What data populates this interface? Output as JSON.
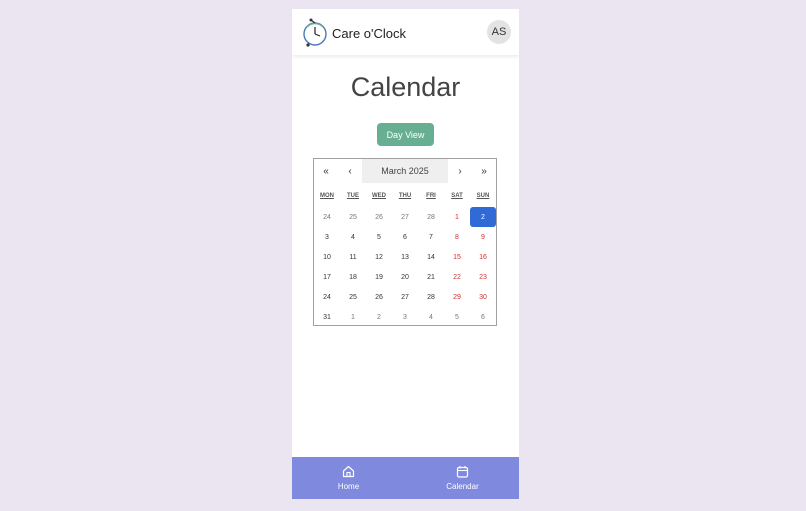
{
  "header": {
    "app_title": "Care o'Clock",
    "avatar_initials": "AS",
    "logo_icon": "clock-logo-icon"
  },
  "page": {
    "title": "Calendar",
    "day_view_label": "Day View"
  },
  "calendar": {
    "prev_year": "«",
    "prev_month": "‹",
    "month_label": "March 2025",
    "next_month": "›",
    "next_year": "»",
    "weekdays": [
      "MON",
      "TUE",
      "WED",
      "THU",
      "FRI",
      "SAT",
      "SUN"
    ],
    "weeks": [
      [
        "24",
        "25",
        "26",
        "27",
        "28",
        "1",
        "2"
      ],
      [
        "3",
        "4",
        "5",
        "6",
        "7",
        "8",
        "9"
      ],
      [
        "10",
        "11",
        "12",
        "13",
        "14",
        "15",
        "16"
      ],
      [
        "17",
        "18",
        "19",
        "20",
        "21",
        "22",
        "23"
      ],
      [
        "24",
        "25",
        "26",
        "27",
        "28",
        "29",
        "30"
      ],
      [
        "31",
        "1",
        "2",
        "3",
        "4",
        "5",
        "6"
      ]
    ],
    "selected_day": "2",
    "colors": {
      "weekend": "#d0312d",
      "selected": "#2f6ad6",
      "other_month": "#777777"
    }
  },
  "bottom_nav": {
    "items": [
      {
        "label": "Home",
        "icon": "home-icon"
      },
      {
        "label": "Calendar",
        "icon": "calendar-icon"
      }
    ],
    "color": "#7f89dd"
  },
  "colors": {
    "background": "#ebe5f1",
    "accent_button": "#67ae92"
  }
}
